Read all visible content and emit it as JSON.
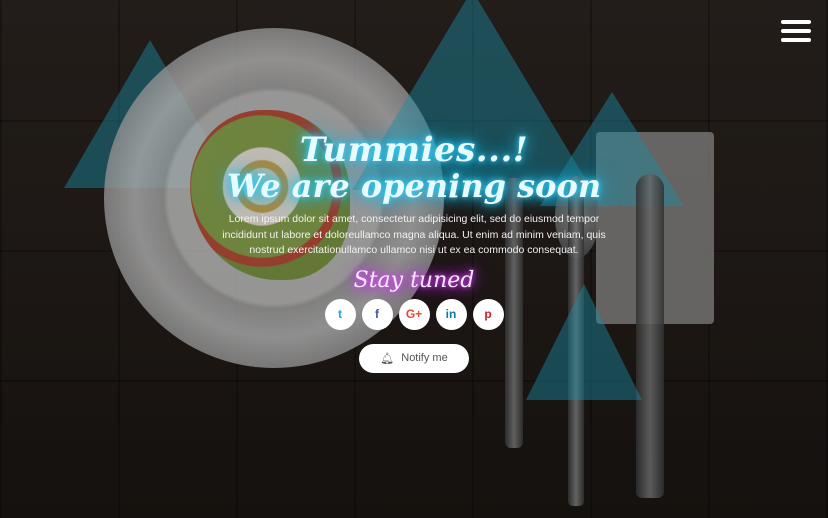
{
  "header": {
    "menu_icon": "hamburger-menu-icon"
  },
  "hero": {
    "title_line1": "Tummies...!",
    "title_line2": "We are opening soon",
    "description": "Lorem ipsum dolor sit amet, consectetur adipisicing elit, sed do eiusmod tempor incididunt ut labore et doloreullamco magna aliqua. Ut enim ad minim veniam, quis nostrud exercitationullamco ullamco nisi ut ex ea commodo consequat.",
    "stay_tuned": "Stay tuned"
  },
  "social": [
    {
      "name": "twitter",
      "icon": "twitter-icon",
      "glyph": "t",
      "color": "#1da1f2"
    },
    {
      "name": "facebook",
      "icon": "facebook-icon",
      "glyph": "f",
      "color": "#3b5998"
    },
    {
      "name": "google-plus",
      "icon": "google-plus-icon",
      "glyph": "G+",
      "color": "#dd4b39"
    },
    {
      "name": "linkedin",
      "icon": "linkedin-icon",
      "glyph": "in",
      "color": "#0e76a8"
    },
    {
      "name": "pinterest",
      "icon": "pinterest-icon",
      "glyph": "p",
      "color": "#cb2027"
    }
  ],
  "notify": {
    "label": "Notify me",
    "icon": "bell-icon"
  },
  "colors": {
    "accent_cyan": "#21bde8",
    "accent_magenta": "#c62ef0"
  }
}
